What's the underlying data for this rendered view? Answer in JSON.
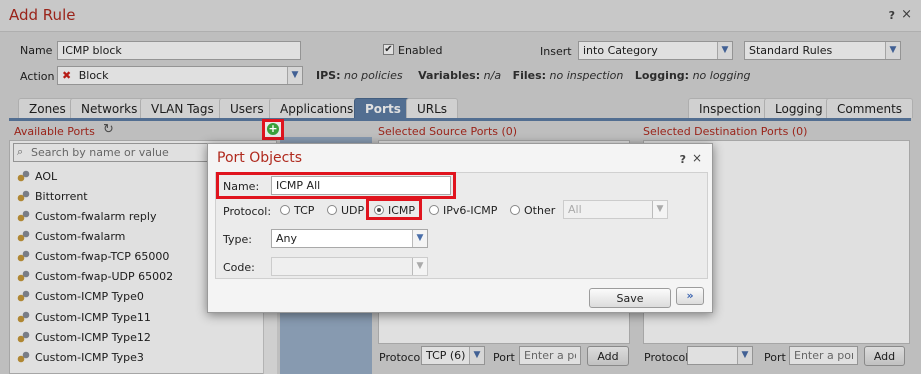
{
  "window": {
    "title": "Add Rule",
    "help": "?",
    "close": "×"
  },
  "header": {
    "name_label": "Name",
    "name_value": "ICMP block",
    "enabled_label": "Enabled",
    "enabled_check": "✔",
    "insert_label": "Insert",
    "insert_value": "into Category",
    "category_value": "Standard Rules",
    "action_label": "Action",
    "action_icon": "✖",
    "action_value": "Block",
    "ips_label": "IPS:",
    "ips_value": "no policies",
    "variables_label": "Variables:",
    "variables_value": "n/a",
    "files_label": "Files:",
    "files_value": "no inspection",
    "logging_label": "Logging:",
    "logging_value": "no logging"
  },
  "tabs": [
    {
      "label": "Zones"
    },
    {
      "label": "Networks"
    },
    {
      "label": "VLAN Tags"
    },
    {
      "label": "Users"
    },
    {
      "label": "Applications"
    },
    {
      "label": "Ports"
    },
    {
      "label": "URLs"
    },
    {
      "label": "Inspection"
    },
    {
      "label": "Logging"
    },
    {
      "label": "Comments"
    }
  ],
  "available": {
    "title": "Available Ports",
    "refresh_icon": "↻",
    "add_icon": "+",
    "search_icon": "⌕",
    "search_placeholder": "Search by name or value",
    "items": [
      {
        "label": "AOL"
      },
      {
        "label": "Bittorrent"
      },
      {
        "label": "Custom-fwalarm reply"
      },
      {
        "label": "Custom-fwalarm"
      },
      {
        "label": "Custom-fwap-TCP 65000"
      },
      {
        "label": "Custom-fwap-UDP 65002"
      },
      {
        "label": "Custom-ICMP Type0"
      },
      {
        "label": "Custom-ICMP Type11"
      },
      {
        "label": "Custom-ICMP Type12"
      },
      {
        "label": "Custom-ICMP Type3"
      }
    ]
  },
  "source": {
    "title": "Selected Source Ports (0)",
    "protocol_label": "Protocol",
    "protocol_value": "TCP (6)",
    "port_label": "Port",
    "port_placeholder": "Enter a port",
    "add_label": "Add"
  },
  "destination": {
    "title": "Selected Destination Ports (0)",
    "protocol_label": "Protocol",
    "protocol_value": "",
    "port_label": "Port",
    "port_placeholder": "Enter a port",
    "add_label": "Add"
  },
  "modal": {
    "title": "Port Objects",
    "help": "?",
    "close": "×",
    "name_label": "Name:",
    "name_value": "ICMP All",
    "protocol_label": "Protocol:",
    "protocols": [
      {
        "label": "TCP",
        "selected": false
      },
      {
        "label": "UDP",
        "selected": false
      },
      {
        "label": "ICMP",
        "selected": true
      },
      {
        "label": "IPv6-ICMP",
        "selected": false
      },
      {
        "label": "Other",
        "selected": false
      }
    ],
    "other_value": "All",
    "type_label": "Type:",
    "type_value": "Any",
    "code_label": "Code:",
    "code_value": "",
    "save_label": "Save",
    "more_label": "»"
  },
  "colors": {
    "accent_red": "#b02a1e",
    "tab_active": "#5e7ea6",
    "highlight": "#e0141e",
    "add_green": "#3aa03a"
  }
}
